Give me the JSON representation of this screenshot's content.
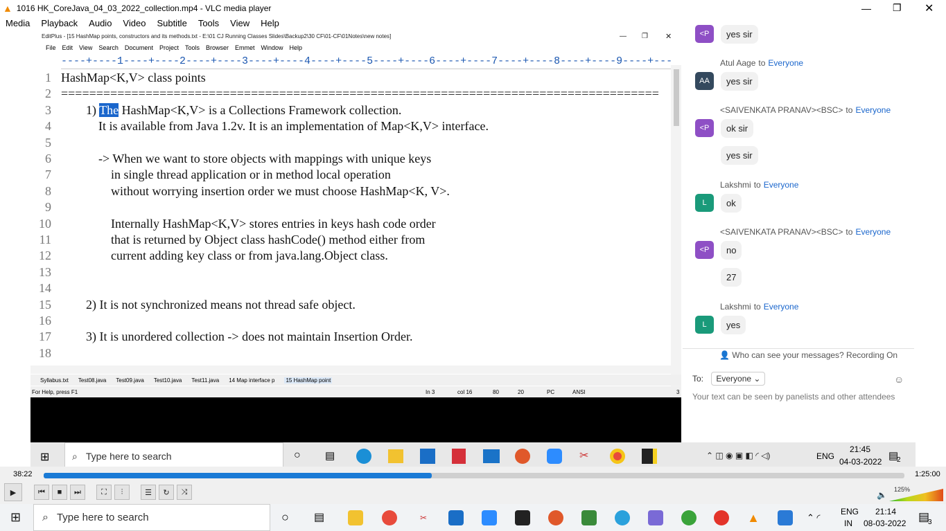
{
  "vlc": {
    "title": "1016 HK_CoreJava_04_03_2022_collection.mp4 - VLC media player",
    "menu": [
      "Media",
      "Playback",
      "Audio",
      "Video",
      "Subtitle",
      "Tools",
      "View",
      "Help"
    ],
    "elapsed": "38:22",
    "total": "1:25:00",
    "volume": "125%",
    "progress": 0.451
  },
  "editplus": {
    "title": "EditPlus - [15 HashMap points, constructors and its methods.txt - E:\\01 CJ Running Classes Slides\\Backup2\\30 CF\\01-CF\\01Notes\\new notes]",
    "menu": [
      "File",
      "Edit",
      "View",
      "Search",
      "Document",
      "Project",
      "Tools",
      "Browser",
      "Emmet",
      "Window",
      "Help"
    ],
    "ruler": "----+----1----+----2----+----3----+----4----+----5----+----6----+----7----+----8----+----9----+----0----+----",
    "lines": [
      {
        "n": "1",
        "pre": "HashMap<K,V> class points",
        "sel": "",
        "post": ""
      },
      {
        "n": "2",
        "pre": "=====================================================================================",
        "sel": "",
        "post": ""
      },
      {
        "n": "3",
        "pre": "        1) ",
        "sel": "The",
        "post": " HashMap<K,V> is a Collections Framework collection."
      },
      {
        "n": "4",
        "pre": "            It is available from Java 1.2v. It is an implementation of Map<K,V> interface.",
        "sel": "",
        "post": ""
      },
      {
        "n": "5",
        "pre": "",
        "sel": "",
        "post": ""
      },
      {
        "n": "6",
        "pre": "            -> When we want to store objects with mappings with unique keys",
        "sel": "",
        "post": ""
      },
      {
        "n": "7",
        "pre": "                in single thread application or in method local operation",
        "sel": "",
        "post": ""
      },
      {
        "n": "8",
        "pre": "                without worrying insertion order we must choose HashMap<K, V>.",
        "sel": "",
        "post": ""
      },
      {
        "n": "9",
        "pre": "",
        "sel": "",
        "post": ""
      },
      {
        "n": "10",
        "pre": "                Internally HashMap<K,V> stores entries in keys hash code order",
        "sel": "",
        "post": ""
      },
      {
        "n": "11",
        "pre": "                that is returned by Object class hashCode() method either from",
        "sel": "",
        "post": ""
      },
      {
        "n": "12",
        "pre": "                current adding key class or from java.lang.Object class.",
        "sel": "",
        "post": ""
      },
      {
        "n": "13",
        "pre": "",
        "sel": "",
        "post": ""
      },
      {
        "n": "14",
        "pre": "",
        "sel": "",
        "post": ""
      },
      {
        "n": "15",
        "pre": "        2) It is not synchronized means not thread safe object.",
        "sel": "",
        "post": ""
      },
      {
        "n": "16",
        "pre": "",
        "sel": "",
        "post": ""
      },
      {
        "n": "17",
        "pre": "        3) It is unordered collection -> does not maintain Insertion Order.",
        "sel": "",
        "post": ""
      },
      {
        "n": "18",
        "pre": "",
        "sel": "",
        "post": ""
      }
    ],
    "tabs": [
      "Syllabus.txt",
      "Test08.java",
      "Test09.java",
      "Test10.java",
      "Test11.java",
      "14 Map interface p",
      "15 HashMap point"
    ],
    "status": {
      "help": "For Help, press F1",
      "ln": "In 3",
      "col": "col 16",
      "a": "80",
      "b": "20",
      "mode": "PC",
      "enc": "ANSI",
      "num": "3"
    }
  },
  "chat": {
    "messages": [
      {
        "sender": "",
        "to": "",
        "initials": "<P",
        "color": "#8e4fc5",
        "texts": [
          "yes sir"
        ]
      },
      {
        "sender": "Atul Aage",
        "to": "Everyone",
        "initials": "AA",
        "color": "#34495e",
        "texts": [
          "yes sir"
        ]
      },
      {
        "sender": "<SAIVENKATA PRANAV><BSC>",
        "to": "Everyone",
        "initials": "<P",
        "color": "#8e4fc5",
        "texts": [
          "ok sir",
          "yes sir"
        ]
      },
      {
        "sender": "Lakshmi",
        "to": "Everyone",
        "initials": "L",
        "color": "#1a9a7a",
        "texts": [
          "ok"
        ]
      },
      {
        "sender": "<SAIVENKATA PRANAV><BSC>",
        "to": "Everyone",
        "initials": "<P",
        "color": "#8e4fc5",
        "texts": [
          "no",
          "27"
        ]
      },
      {
        "sender": "Lakshmi",
        "to": "Everyone",
        "initials": "L",
        "color": "#1a9a7a",
        "texts": [
          "yes"
        ]
      }
    ],
    "to_word": "to",
    "who_can_see": "Who can see your messages? Recording On",
    "to_label": "To:",
    "to_value": "Everyone",
    "input_placeholder": "Your text can be seen by panelists and other attendees"
  },
  "inner_taskbar": {
    "search": "Type here to search",
    "time": "21:45",
    "date": "04-03-2022",
    "lang": "ENG",
    "notif": "2"
  },
  "taskbar": {
    "search": "Type here to search",
    "time": "21:14",
    "date": "08-03-2022",
    "lang": "ENG",
    "region": "IN",
    "notif": "3"
  }
}
